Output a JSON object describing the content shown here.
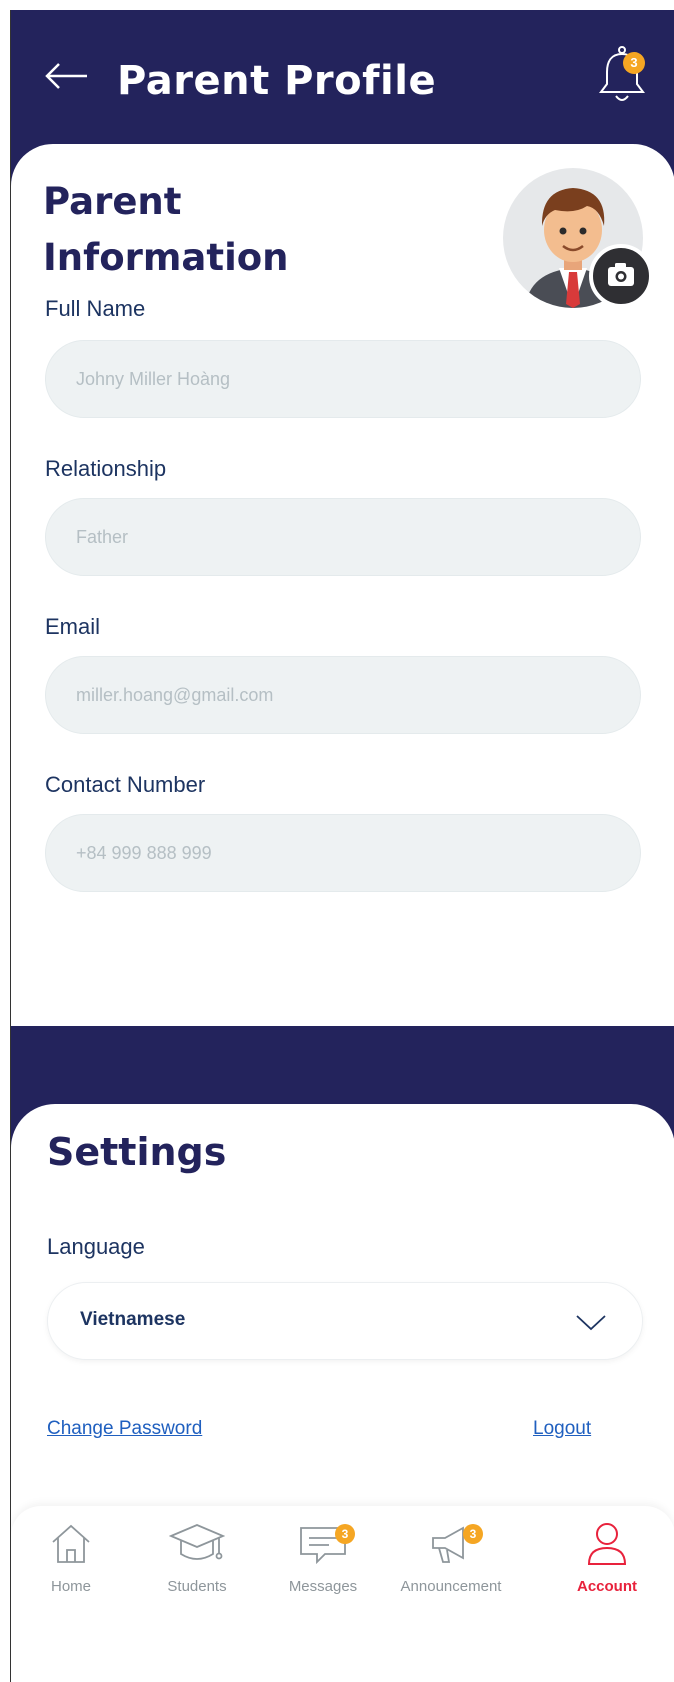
{
  "header": {
    "title": "Parent Profile",
    "notification_count": "3"
  },
  "parent_info": {
    "section_title": "Parent Information",
    "fields": [
      {
        "label": "Full Name",
        "value": "Johny Miller Hoàng"
      },
      {
        "label": "Relationship",
        "value": "Father"
      },
      {
        "label": "Email",
        "value": "miller.hoang@gmail.com"
      },
      {
        "label": "Contact Number",
        "value": "+84 999 888 999"
      }
    ]
  },
  "settings": {
    "title": "Settings",
    "language_label": "Language",
    "language_value": "Vietnamese",
    "change_password": "Change Password",
    "logout": "Logout"
  },
  "nav": {
    "items": [
      {
        "label": "Home",
        "icon": "home-icon"
      },
      {
        "label": "Students",
        "icon": "graduation-cap-icon"
      },
      {
        "label": "Messages",
        "icon": "message-icon",
        "badge": "3"
      },
      {
        "label": "Announcement",
        "icon": "megaphone-icon",
        "badge": "3"
      },
      {
        "label": "Account",
        "icon": "user-icon",
        "active": true
      }
    ]
  },
  "colors": {
    "navy": "#23235c",
    "label_blue": "#1d3461",
    "link_blue": "#1f5fbf",
    "active_red": "#e8223c",
    "badge_orange": "#f5a623",
    "input_bg": "#eef2f3"
  }
}
